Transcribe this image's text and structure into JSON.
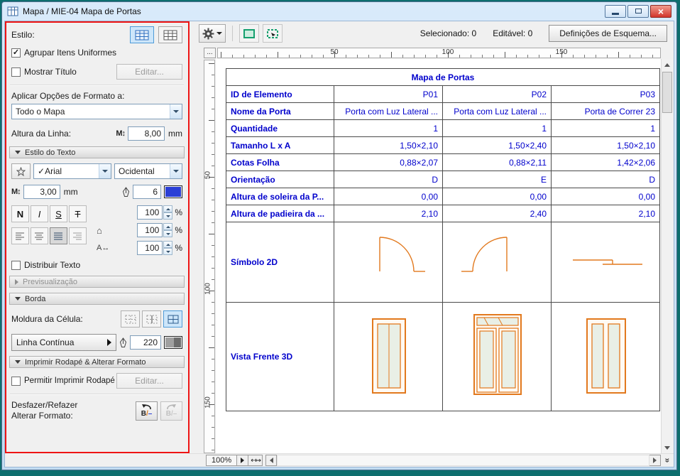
{
  "window": {
    "title": "Mapa / MIE-04 Mapa de Portas"
  },
  "toolbar": {
    "selected": "Selecionado: 0",
    "editable": "Editável: 0",
    "schema_button": "Definições de Esquema..."
  },
  "panel": {
    "estilo": "Estilo:",
    "agrupar": "Agrupar Itens Uniformes",
    "mostrar": "Mostrar Título",
    "editar": "Editar...",
    "aplicar": "Aplicar Opções de Formato a:",
    "aplicar_value": "Todo o Mapa",
    "altura": "Altura da Linha:",
    "altura_value": "8,00",
    "mm": "mm",
    "texto_header": "Estilo do Texto",
    "font": "Arial",
    "script": "Ocidental",
    "size_value": "3,00",
    "pen_value": "6",
    "bold": "N",
    "italic": "I",
    "underline": "S",
    "strike": "T",
    "sp1": "100",
    "sp2": "100",
    "sp3": "100",
    "pct": "%",
    "distribuir": "Distribuir Texto",
    "preview_header": "Previsualização",
    "borda_header": "Borda",
    "moldura": "Moldura da Célula:",
    "linha": "Linha Contínua",
    "espessura": "220",
    "rodape_header": "Imprimir Rodapé & Alterar Formato",
    "permitir": "Permitir Imprimir Rodapé",
    "editar2": "Editar...",
    "undo1": "Desfazer/Refazer",
    "undo2": "Alterar Formato:",
    "ub": "B",
    "us": "/",
    "ud": "–"
  },
  "rulers": {
    "corner": "...",
    "h": [
      "50",
      "100",
      "150"
    ],
    "v": [
      "50",
      "100",
      "150"
    ]
  },
  "table": {
    "title": "Mapa de Portas",
    "rows": [
      {
        "label": "ID de Elemento",
        "values": [
          "P01",
          "P02",
          "P03"
        ]
      },
      {
        "label": "Nome da Porta",
        "values": [
          "Porta com Luz Lateral ...",
          "Porta com Luz Lateral ...",
          "Porta de Correr 23"
        ]
      },
      {
        "label": "Quantidade",
        "values": [
          "1",
          "1",
          "1"
        ]
      },
      {
        "label": "Tamanho L x A",
        "values": [
          "1,50×2,10",
          "1,50×2,40",
          "1,50×2,10"
        ]
      },
      {
        "label": "Cotas Folha",
        "values": [
          "0,88×2,07",
          "0,88×2,11",
          "1,42×2,06"
        ]
      },
      {
        "label": "Orientação",
        "values": [
          "D",
          "E",
          "D"
        ]
      },
      {
        "label": "Altura de soleira da P...",
        "values": [
          "0,00",
          "0,00",
          "0,00"
        ]
      },
      {
        "label": "Altura de padieira da ...",
        "values": [
          "2,10",
          "2,40",
          "2,10"
        ]
      }
    ],
    "symbol_label": "Símbolo 2D",
    "vista_label": "Vista Frente 3D"
  },
  "statusbar": {
    "zoom": "100%"
  },
  "colors": {
    "table_text_blue": "#0000cc",
    "door_orange": "#e2791e",
    "annotation_red": "#ee1414",
    "titlebar_blue": "#cfe3f5"
  }
}
